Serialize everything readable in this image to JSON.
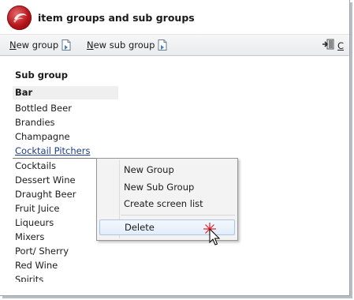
{
  "window": {
    "title": "item groups and sub groups"
  },
  "toolbar": {
    "new_group": "New group",
    "new_sub_group": "New sub group",
    "exit_partial": "C"
  },
  "panel": {
    "section_title": "Sub group",
    "group_name": "Bar",
    "items": [
      "Bottled Beer",
      "Brandies",
      "Champagne",
      "Cocktail Pitchers",
      "Cocktails",
      "Dessert Wine",
      "Draught Beer",
      "Fruit Juice",
      "Liqueurs",
      "Mixers",
      "Port/ Sherry",
      "Red Wine",
      "Spirits"
    ],
    "selected_item": "Cocktail Pitchers"
  },
  "context_menu": {
    "items": [
      "New Group",
      "New Sub Group",
      "Create screen list"
    ],
    "delete": "Delete",
    "hovered": "Delete"
  },
  "colors": {
    "logo": "#b3141b",
    "selected_link": "#1a3e8c",
    "menu_hover_border": "#a9c4e8"
  }
}
